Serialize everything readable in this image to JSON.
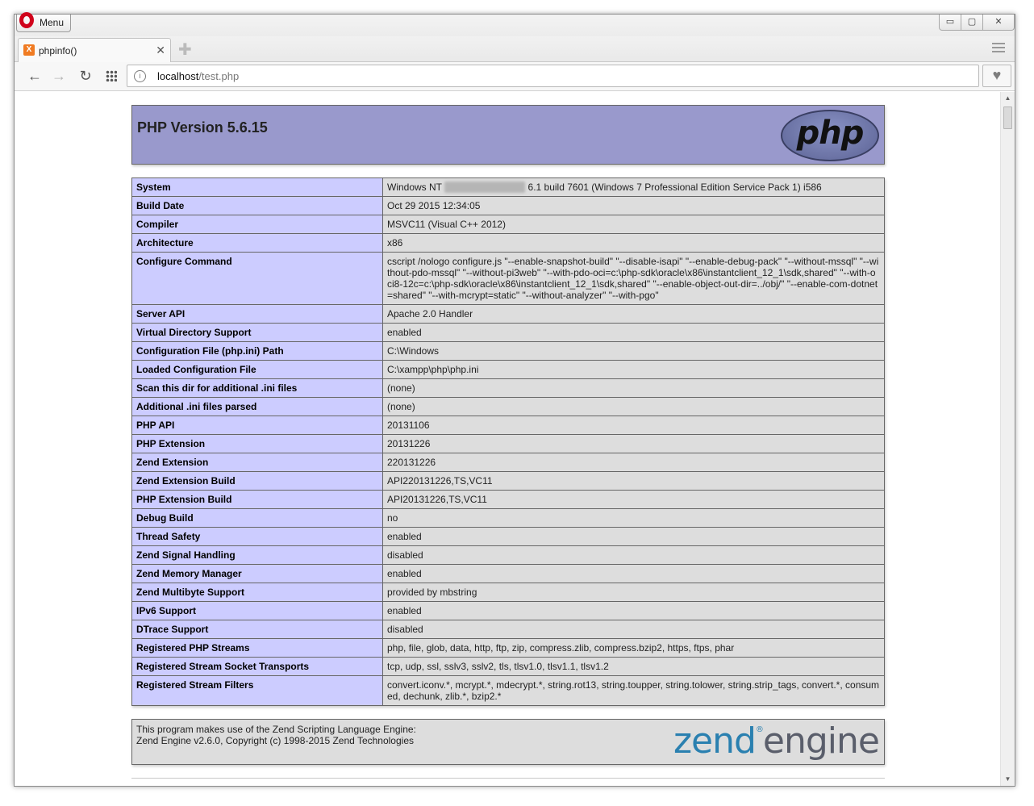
{
  "browser": {
    "menu_label": "Menu",
    "tab": {
      "title": "phpinfo()",
      "favicon_letter": "X"
    },
    "window_controls": {
      "minimize": "▭",
      "maximize": "▢",
      "close": "✕"
    },
    "address": {
      "host": "localhost",
      "path": "/test.php"
    }
  },
  "page": {
    "title": "PHP Version 5.6.15",
    "logo_text": "php",
    "rows": [
      {
        "key": "System",
        "value": "Windows NT ########## 6.1 build 7601 (Windows 7 Professional Edition Service Pack 1) i586",
        "value_pre": "Windows NT ",
        "value_redacted": "XXXXX-XXXXXXX",
        "value_post": " 6.1 build 7601 (Windows 7 Professional Edition Service Pack 1) i586"
      },
      {
        "key": "Build Date",
        "value": "Oct 29 2015 12:34:05"
      },
      {
        "key": "Compiler",
        "value": "MSVC11 (Visual C++ 2012)"
      },
      {
        "key": "Architecture",
        "value": "x86"
      },
      {
        "key": "Configure Command",
        "value": "cscript /nologo configure.js \"--enable-snapshot-build\" \"--disable-isapi\" \"--enable-debug-pack\" \"--without-mssql\" \"--without-pdo-mssql\" \"--without-pi3web\" \"--with-pdo-oci=c:\\php-sdk\\oracle\\x86\\instantclient_12_1\\sdk,shared\" \"--with-oci8-12c=c:\\php-sdk\\oracle\\x86\\instantclient_12_1\\sdk,shared\" \"--enable-object-out-dir=../obj/\" \"--enable-com-dotnet=shared\" \"--with-mcrypt=static\" \"--without-analyzer\" \"--with-pgo\""
      },
      {
        "key": "Server API",
        "value": "Apache 2.0 Handler"
      },
      {
        "key": "Virtual Directory Support",
        "value": "enabled"
      },
      {
        "key": "Configuration File (php.ini) Path",
        "value": "C:\\Windows"
      },
      {
        "key": "Loaded Configuration File",
        "value": "C:\\xampp\\php\\php.ini"
      },
      {
        "key": "Scan this dir for additional .ini files",
        "value": "(none)"
      },
      {
        "key": "Additional .ini files parsed",
        "value": "(none)"
      },
      {
        "key": "PHP API",
        "value": "20131106"
      },
      {
        "key": "PHP Extension",
        "value": "20131226"
      },
      {
        "key": "Zend Extension",
        "value": "220131226"
      },
      {
        "key": "Zend Extension Build",
        "value": "API220131226,TS,VC11"
      },
      {
        "key": "PHP Extension Build",
        "value": "API20131226,TS,VC11"
      },
      {
        "key": "Debug Build",
        "value": "no"
      },
      {
        "key": "Thread Safety",
        "value": "enabled"
      },
      {
        "key": "Zend Signal Handling",
        "value": "disabled"
      },
      {
        "key": "Zend Memory Manager",
        "value": "enabled"
      },
      {
        "key": "Zend Multibyte Support",
        "value": "provided by mbstring"
      },
      {
        "key": "IPv6 Support",
        "value": "enabled"
      },
      {
        "key": "DTrace Support",
        "value": "disabled"
      },
      {
        "key": "Registered PHP Streams",
        "value": "php, file, glob, data, http, ftp, zip, compress.zlib, compress.bzip2, https, ftps, phar"
      },
      {
        "key": "Registered Stream Socket Transports",
        "value": "tcp, udp, ssl, sslv3, sslv2, tls, tlsv1.0, tlsv1.1, tlsv1.2"
      },
      {
        "key": "Registered Stream Filters",
        "value": "convert.iconv.*, mcrypt.*, mdecrypt.*, string.rot13, string.toupper, string.tolower, string.strip_tags, convert.*, consumed, dechunk, zlib.*, bzip2.*"
      }
    ],
    "zend": {
      "line1": "This program makes use of the Zend Scripting Language Engine:",
      "line2": "Zend Engine v2.6.0, Copyright (c) 1998-2015 Zend Technologies",
      "logo_zend": "zend",
      "logo_engine": "engine",
      "logo_mark": "®"
    }
  },
  "colors": {
    "header_bg": "#9999cc",
    "key_bg": "#ccccff",
    "value_bg": "#dddddd",
    "border": "#666666"
  }
}
